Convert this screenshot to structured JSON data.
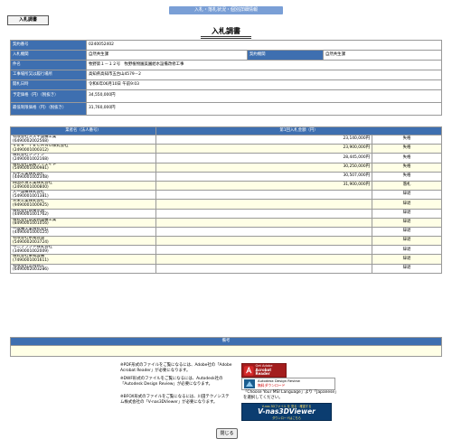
{
  "header": {
    "top_bar": "入札・落札状況・個別詳細情報",
    "tab_label": "入札調書",
    "title": "入札調書"
  },
  "info": {
    "contract_no_label": "契約番号",
    "contract_no": "0240052402",
    "bid_org_label": "入札機関",
    "bid_org": "自然共生課",
    "contract_org_label": "契約機関",
    "contract_org": "自然共生課",
    "project_label": "件名",
    "project": "牧野第１－１２号　牧野植物園美園給水設備改修工事",
    "location_label": "工事場所又は履行場所",
    "location": "高知県高知市五台山4579－2",
    "date_label": "開札日時",
    "date": "令和6年06月10日 午前9:03",
    "planned_label": "予定価格（円）（税抜き）",
    "planned": "34,550,000円",
    "min_label": "最低制限価格（円）（税抜き）",
    "min": "31,760,000円"
  },
  "bids": {
    "col_name": "業者名（法人番号）",
    "col_amount": "第1回入札金額（円）",
    "rows": [
      {
        "name": "有限会社スズキ設備工業",
        "id": "(6490002002568)",
        "amount": "23,140,000円",
        "status": "失格"
      },
      {
        "name": "ＶＥＲ　ＴＥＣＨＮＯ株式会社",
        "id": "(2490001000312)",
        "amount": "23,900,000円",
        "status": "失格"
      },
      {
        "name": "株式会社シンゲン",
        "id": "(2490001002168)",
        "amount": "28,445,000円",
        "status": "失格"
      },
      {
        "name": "株式会社高知クリエイト",
        "id": "(5490001000981)",
        "amount": "30,250,000円",
        "status": "失格"
      },
      {
        "name": "丸平工業株式会社",
        "id": "(4490001002348)",
        "amount": "30,507,000円",
        "status": "失格"
      },
      {
        "name": "四国水道工業株式会社",
        "id": "(2490001000800)",
        "amount": "31,900,000円",
        "status": "落札"
      },
      {
        "name": "大一設備株式会社",
        "id": "(5490001001381)",
        "amount": "",
        "status": "辞退"
      },
      {
        "name": "三栄工業株式会社",
        "id": "(9490001000925)",
        "amount": "",
        "status": "辞退"
      },
      {
        "name": "株式会社日東水道",
        "id": "(4490001001762)",
        "amount": "",
        "status": "辞退"
      },
      {
        "name": "株式会社高美商設備工業",
        "id": "(8490001001016)",
        "amount": "",
        "status": "辞退"
      },
      {
        "name": "一設備工業株式会社",
        "id": "(4490001000125)",
        "amount": "",
        "status": "辞退"
      },
      {
        "name": "有限会社永尾建設",
        "id": "(5490002003724)",
        "amount": "",
        "status": "辞退"
      },
      {
        "name": "不二プラント株式会社",
        "id": "(3490001002009)",
        "amount": "",
        "status": "辞退"
      },
      {
        "name": "株式会社東和設備",
        "id": "(7490001001611)",
        "amount": "",
        "status": "辞退"
      },
      {
        "name": "有限会社宮崎商工",
        "id": "(6490002003286)",
        "amount": "",
        "status": "辞退"
      }
    ]
  },
  "remarks": {
    "label": "備考",
    "text": ""
  },
  "notes": [
    "※PDF形式のファイルをご覧になるには、Adobe社の「Adobe Acrobat Reader」が必要になります。",
    "※DWF形式のファイルをご覧になるには、Autodesk社の「Autodesk Design Review」が必要になります。",
    "※BFOX形式のファイルをご覧になるには、川田テクノシステム株式会社の「V-nas3DViewer」が必要になります。"
  ],
  "badges": {
    "adobe_top": "Get Adobe",
    "adobe_main": "Acrobat Reader",
    "adr_line1": "Autodesk Design Review",
    "adr_line2": "無料ダウンロード",
    "msi_text": "「Choose Your MSI Language」より「Japanese」を選択してください。",
    "vnas_top": "V-nas 3Dファイル を 見る・確認する",
    "vnas_main": "V-nas3DViewer",
    "vnas_sub": "ダウンロードはこちら"
  },
  "close_label": "閉じる",
  "colors": {
    "accent": "#3e6fb0",
    "topbar": "#7a9fd6",
    "row_alt": "#ffffe6"
  }
}
